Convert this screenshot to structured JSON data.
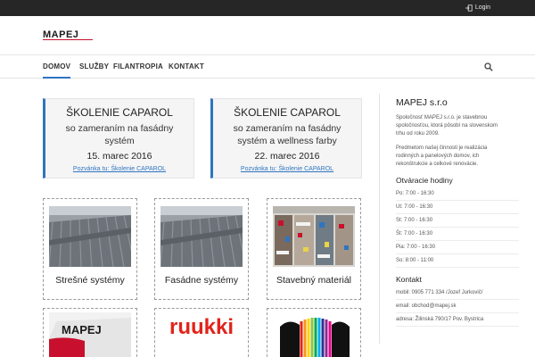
{
  "topbar": {
    "login_label": "Login"
  },
  "header": {
    "logo_text": "MAPEJ"
  },
  "nav": {
    "items": [
      "DOMOV",
      "SLUŽBY",
      "FILANTROPIA",
      "KONTAKT"
    ],
    "active": "DOMOV"
  },
  "promos": [
    {
      "title": "ŠKOLENIE CAPAROL",
      "subtitle": "so zameraním na fasádny systém",
      "date": "15. marec 2016",
      "link": "Pozvánka tu: Školenie CAPAROL"
    },
    {
      "title": "ŠKOLENIE CAPAROL",
      "subtitle": "so zameraním na fasádny systém a wellness farby",
      "date": "22. marec 2016",
      "link": "Pozvánka tu: Školenie CAPAROL"
    }
  ],
  "tiles": [
    {
      "caption": "Strešné systémy"
    },
    {
      "caption": "Fasádne systémy"
    },
    {
      "caption": "Stavebný materiál"
    }
  ],
  "bottom_tiles": [
    {
      "logo_text": "MAPEJ"
    },
    {
      "logo_text": "RUUKKI"
    },
    {
      "logo_text": ""
    }
  ],
  "sidebar": {
    "title": "MAPEJ s.r.o",
    "about_1": "Spoločnosť MAPEJ s.r.o. je stavebnou spoločnosťou, ktorá pôsobí na slovenskom trhu od roku 2009.",
    "about_2": "Predmetom našej činnosti je realizácia rodinných a panelových domov, ich rekonštrukcie a celkové renovácie.",
    "hours_title": "Otváracie hodiny",
    "hours": [
      "Po: 7:00 - 16:30",
      "Ut: 7:00 - 16:30",
      "St: 7:00 - 16:30",
      "Št: 7:00 - 16:30",
      "Pia: 7:00 - 16:30",
      "So: 8:00 - 11:00"
    ],
    "contact_title": "Kontakt",
    "contacts": [
      "mobil: 0905 771 334 /Jozef Jurkovič/",
      "email: obchod@mapej.sk",
      "adresa: Žilinská 790/17 Pov. Bystrica"
    ]
  },
  "colors": {
    "accent": "#2f74c0",
    "topbar": "#262626",
    "logo_red": "#c8102e",
    "ruukki_red": "#e2231a"
  }
}
